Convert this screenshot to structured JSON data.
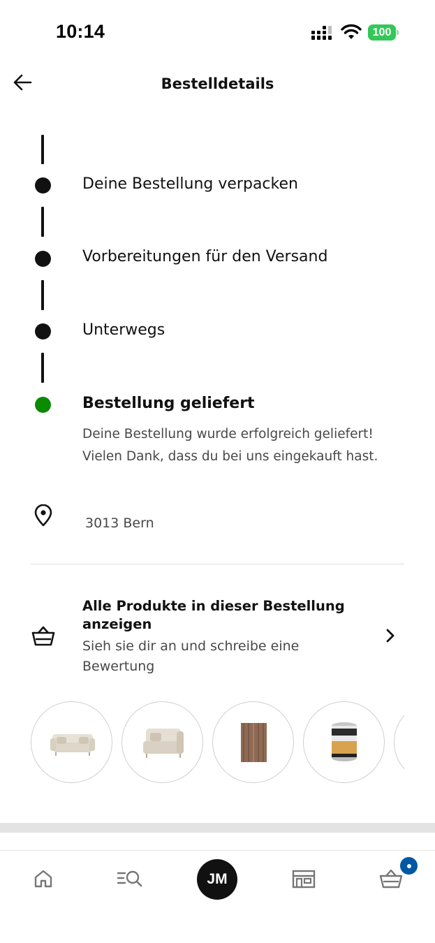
{
  "status_bar": {
    "time": "10:14",
    "battery": "100",
    "icons": [
      "signal-icon",
      "wifi-icon",
      "battery-icon"
    ]
  },
  "header": {
    "title": "Bestelldetails",
    "back_icon": "arrow-left-icon"
  },
  "timeline": {
    "steps": [
      {
        "label": "Deine Bestellung verpacken",
        "state": "done"
      },
      {
        "label": "Vorbereitungen für den Versand",
        "state": "done"
      },
      {
        "label": "Unterwegs",
        "state": "done"
      },
      {
        "label": "Bestellung geliefert",
        "state": "current"
      }
    ],
    "current_description": "Deine Bestellung wurde erfolgreich geliefert! Vielen Dank, dass du bei uns eingekauft hast.",
    "colors": {
      "done": "#111111",
      "current": "#0a8a00"
    }
  },
  "address": {
    "icon": "location-pin-icon",
    "text": "3013 Bern"
  },
  "products": {
    "icon": "basket-icon",
    "title": "Alle Produkte in dieser Bestellung anzeigen",
    "subtitle": "Sieh sie dir an und schreibe eine Bewertung",
    "chevron_icon": "chevron-right-icon",
    "thumbnails": [
      "sofa",
      "armchair-module",
      "rug",
      "paint-can",
      "partial-item"
    ]
  },
  "bottom_nav": {
    "items": [
      {
        "name": "home",
        "icon": "home-icon"
      },
      {
        "name": "search",
        "icon": "search-list-icon"
      },
      {
        "name": "profile",
        "avatar_initials": "JM"
      },
      {
        "name": "store",
        "icon": "store-icon"
      },
      {
        "name": "cart",
        "icon": "basket-icon",
        "badge_color": "#0058a3"
      }
    ]
  }
}
